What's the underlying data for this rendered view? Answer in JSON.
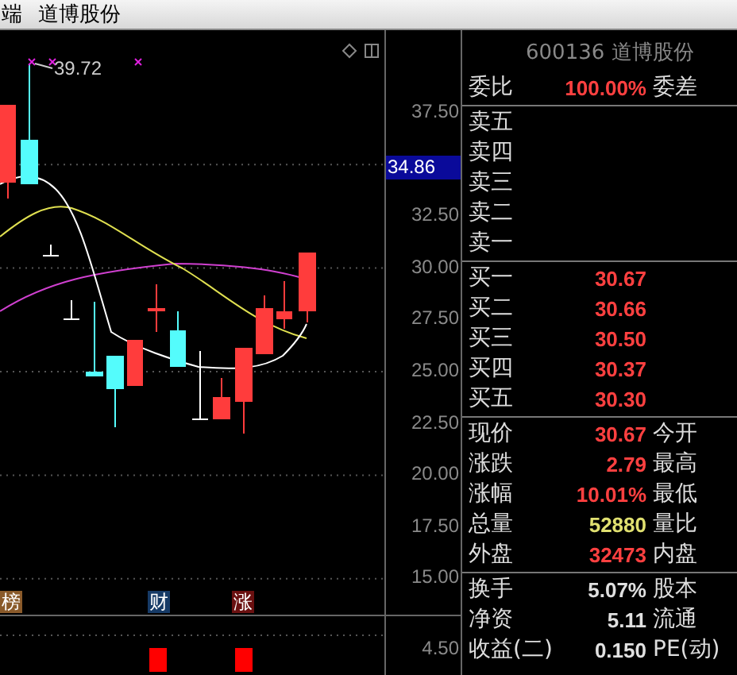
{
  "title_bar": {
    "title_cut": "端",
    "stock_name": "道博股份"
  },
  "chart": {
    "high_label": "39.72",
    "price_axis": [
      "37.50",
      "32.50",
      "30.00",
      "27.50",
      "25.00",
      "22.50",
      "20.00",
      "17.50",
      "15.00"
    ],
    "current_price": "34.86",
    "event_tags": [
      {
        "label": "榜",
        "color": "#8a5a2a"
      },
      {
        "label": "财",
        "color": "#163a66"
      },
      {
        "label": "涨",
        "color": "#6a1010"
      }
    ],
    "volume_axis": "4.50"
  },
  "quote": {
    "header": "600136 道博股份",
    "order_ratio": {
      "label": "委比",
      "value": "100.00%",
      "label2": "委差"
    },
    "asks": [
      {
        "label": "卖五"
      },
      {
        "label": "卖四"
      },
      {
        "label": "卖三"
      },
      {
        "label": "卖二"
      },
      {
        "label": "卖一"
      }
    ],
    "bids": [
      {
        "label": "买一",
        "price": "30.67"
      },
      {
        "label": "买二",
        "price": "30.66"
      },
      {
        "label": "买三",
        "price": "30.50"
      },
      {
        "label": "买四",
        "price": "30.37"
      },
      {
        "label": "买五",
        "price": "30.30"
      }
    ],
    "stats": [
      {
        "label": "现价",
        "value": "30.67",
        "label2": "今开",
        "kind": "up"
      },
      {
        "label": "涨跌",
        "value": "2.79",
        "label2": "最高",
        "kind": "up"
      },
      {
        "label": "涨幅",
        "value": "10.01%",
        "label2": "最低",
        "kind": "up"
      },
      {
        "label": "总量",
        "value": "52880",
        "label2": "量比",
        "kind": "volume"
      },
      {
        "label": "外盘",
        "value": "32473",
        "label2": "内盘",
        "kind": "up"
      }
    ],
    "stats2": [
      {
        "label": "换手",
        "value": "5.07%",
        "label2": "股本",
        "kind": "plain"
      },
      {
        "label": "净资",
        "value": "5.11",
        "label2": "流通",
        "kind": "plain"
      },
      {
        "label": "收益(二)",
        "value": "0.150",
        "label2": "PE(动)",
        "kind": "plain"
      }
    ]
  }
}
